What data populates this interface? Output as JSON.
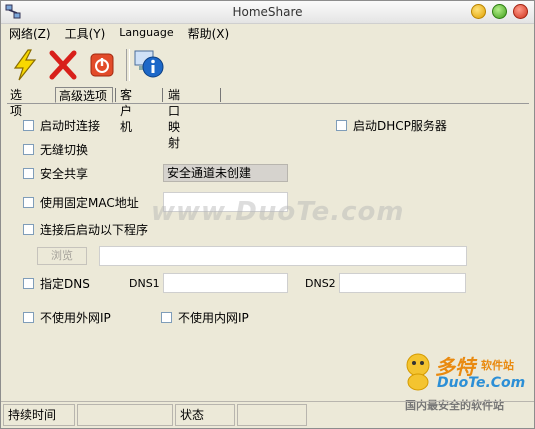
{
  "window": {
    "title": "HomeShare"
  },
  "menu": [
    {
      "label": "网络(Z)"
    },
    {
      "label": "工具(Y)"
    },
    {
      "label": "Language"
    },
    {
      "label": "帮助(X)"
    }
  ],
  "toolbar": {
    "connect_icon": "lightning-icon",
    "disconnect_icon": "red-x-icon",
    "power_icon": "power-icon",
    "info_icon": "info-computer-icon"
  },
  "tabs": [
    {
      "label": "选项"
    },
    {
      "label": "高级选项",
      "active": true
    },
    {
      "label": "客户机"
    },
    {
      "label": "端口映射"
    }
  ],
  "form": {
    "connect_on_start": "启动时连接",
    "start_dhcp": "启动DHCP服务器",
    "seamless_switch": "无缝切换",
    "secure_share": "安全共享",
    "secure_status": "安全通道未创建",
    "fixed_mac": "使用固定MAC地址",
    "fixed_mac_value": "",
    "run_after_connect": "连接后启动以下程序",
    "browse": "浏览",
    "program_path": "",
    "specify_dns": "指定DNS",
    "dns1_label": "DNS1",
    "dns1_value": "",
    "dns2_label": "DNS2",
    "dns2_value": "",
    "no_external_ip": "不使用外网IP",
    "no_internal_ip": "不使用内网IP"
  },
  "watermark": {
    "text": "www.DuoTe.com",
    "logo_cn": "多特",
    "logo_small": "软件站",
    "logo_en": "DuoTe.Com",
    "logo_sub": "国内最安全的软件站"
  },
  "status": {
    "duration_label": "持续时间",
    "duration_value": "",
    "state_label": "状态",
    "state_value": ""
  },
  "colors": {
    "accent_orange": "#e98a10",
    "accent_blue": "#2c8fd6",
    "bg": "#ece9d8"
  }
}
